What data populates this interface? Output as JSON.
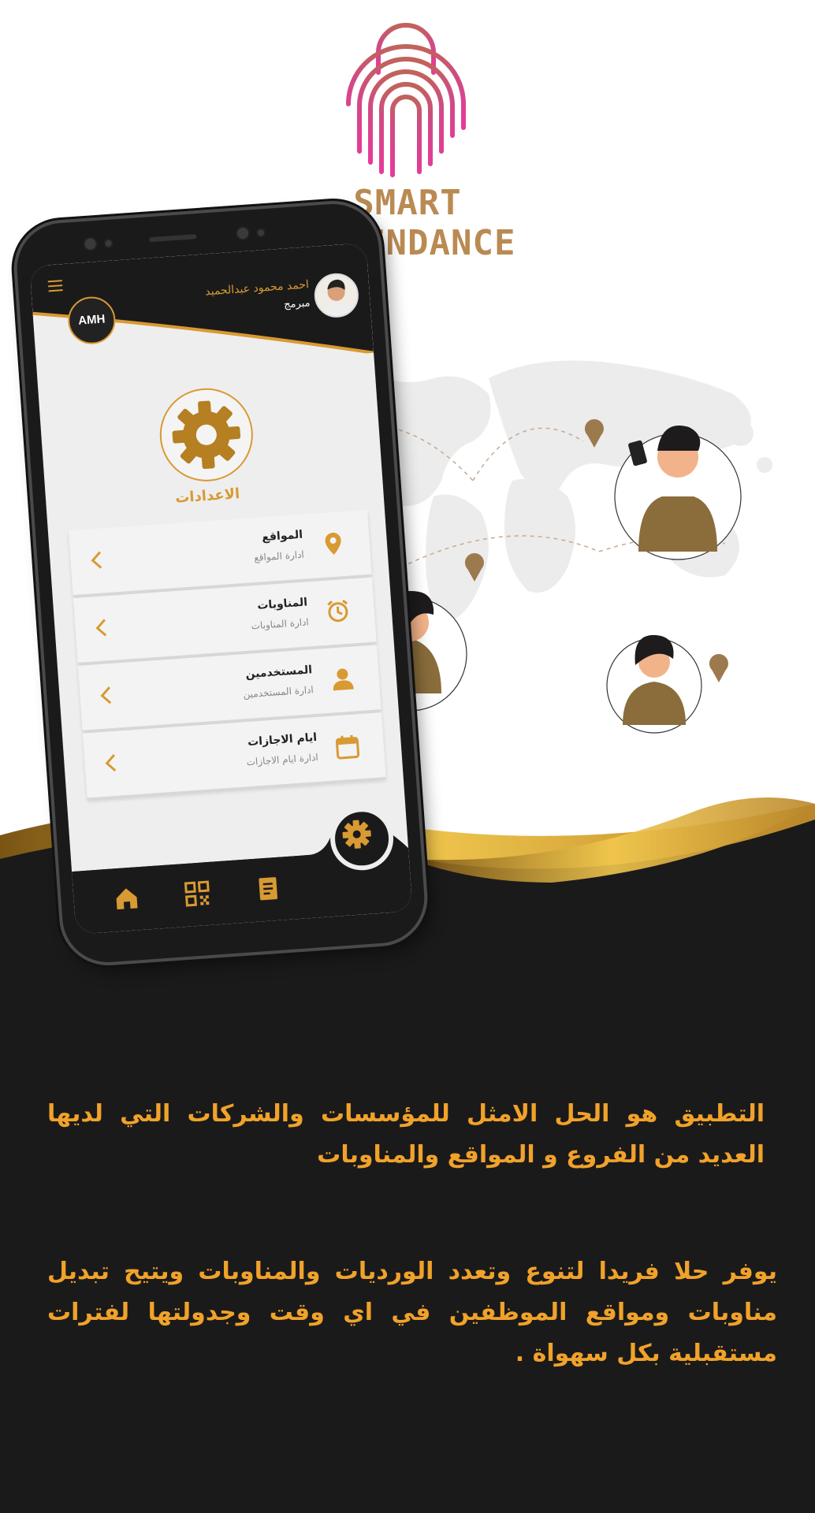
{
  "brand": {
    "name": "SMART ATTENDANCE",
    "icon": "fingerprint-lock-icon"
  },
  "phone": {
    "header": {
      "menu_icon": "hamburger-icon",
      "company_logo_text": "AMH",
      "user_name": "احمد محمود عبدالحميد",
      "user_role": "مبرمج"
    },
    "settings": {
      "icon": "gear-icon",
      "title": "الاعدادات"
    },
    "menu": [
      {
        "title": "المواقع",
        "subtitle": "ادارة المواقع",
        "icon": "location-pin-icon"
      },
      {
        "title": "المناوبات",
        "subtitle": "ادارة المناوبات",
        "icon": "alarm-clock-icon"
      },
      {
        "title": "المستخدمين",
        "subtitle": "ادارة المستخدمين",
        "icon": "user-icon"
      },
      {
        "title": "ايام الاجازات",
        "subtitle": "ادارة ايام الاجازات",
        "icon": "calendar-icon"
      }
    ],
    "bottom_nav": [
      {
        "icon": "home-icon"
      },
      {
        "icon": "qr-code-icon"
      },
      {
        "icon": "document-icon"
      }
    ],
    "fab_icon": "gear-icon"
  },
  "text": {
    "paragraph1": "التطبيق هو الحل الامثل للمؤسسات والشركات التي لديها العديد من الفروع و المواقع والمناوبات",
    "paragraph2": "يوفر حلا فريدا لتنوع وتعدد الورديات والمناوبات ويتيح تبديل مناوبات ومواقع الموظفين في اي وقت وجدولتها لفترات مستقبلية بكل سهواة ."
  },
  "colors": {
    "gold": "#d89a32",
    "orange_text": "#f0a22a",
    "dark": "#1b1a1b",
    "brand_gradient_start": "#e6409a",
    "brand_gradient_end": "#a0522d"
  }
}
